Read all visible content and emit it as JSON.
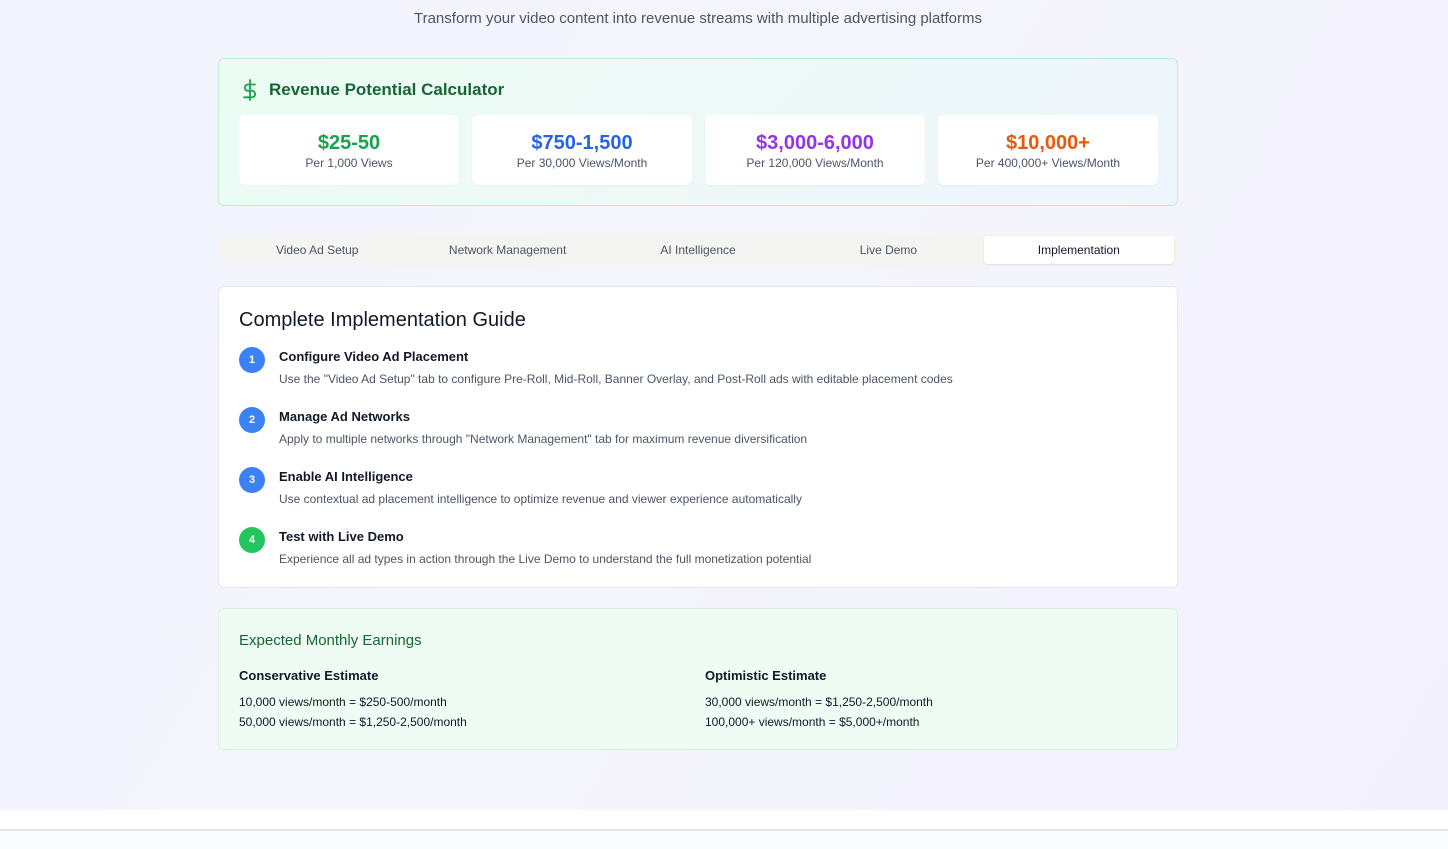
{
  "header": {
    "subtitle": "Transform your video content into revenue streams with multiple advertising platforms"
  },
  "calculator": {
    "title": "Revenue Potential Calculator",
    "icon": "dollar-icon",
    "cards": [
      {
        "value": "$25-50",
        "label": "Per 1,000 Views",
        "color": "#16a34a"
      },
      {
        "value": "$750-1,500",
        "label": "Per 30,000 Views/Month",
        "color": "#2563eb"
      },
      {
        "value": "$3,000-6,000",
        "label": "Per 120,000 Views/Month",
        "color": "#9333ea"
      },
      {
        "value": "$10,000+",
        "label": "Per 400,000+ Views/Month",
        "color": "#ea580c"
      }
    ]
  },
  "tabs": [
    {
      "label": "Video Ad Setup",
      "active": false
    },
    {
      "label": "Network Management",
      "active": false
    },
    {
      "label": "AI Intelligence",
      "active": false
    },
    {
      "label": "Live Demo",
      "active": false
    },
    {
      "label": "Implementation",
      "active": true
    }
  ],
  "guide": {
    "title": "Complete Implementation Guide",
    "steps": [
      {
        "number": "1",
        "title": "Configure Video Ad Placement",
        "description": "Use the \"Video Ad Setup\" tab to configure Pre-Roll, Mid-Roll, Banner Overlay, and Post-Roll ads with editable placement codes",
        "color": "#3b82f6"
      },
      {
        "number": "2",
        "title": "Manage Ad Networks",
        "description": "Apply to multiple networks through \"Network Management\" tab for maximum revenue diversification",
        "color": "#3b82f6"
      },
      {
        "number": "3",
        "title": "Enable AI Intelligence",
        "description": "Use contextual ad placement intelligence to optimize revenue and viewer experience automatically",
        "color": "#3b82f6"
      },
      {
        "number": "4",
        "title": "Test with Live Demo",
        "description": "Experience all ad types in action through the Live Demo to understand the full monetization potential",
        "color": "#22c55e"
      }
    ]
  },
  "earnings": {
    "title": "Expected Monthly Earnings",
    "conservative": {
      "title": "Conservative Estimate",
      "lines": [
        "10,000 views/month = $250-500/month",
        "50,000 views/month = $1,250-2,500/month"
      ]
    },
    "optimistic": {
      "title": "Optimistic Estimate",
      "lines": [
        "30,000 views/month = $1,250-2,500/month",
        "100,000+ views/month = $5,000+/month"
      ]
    }
  }
}
